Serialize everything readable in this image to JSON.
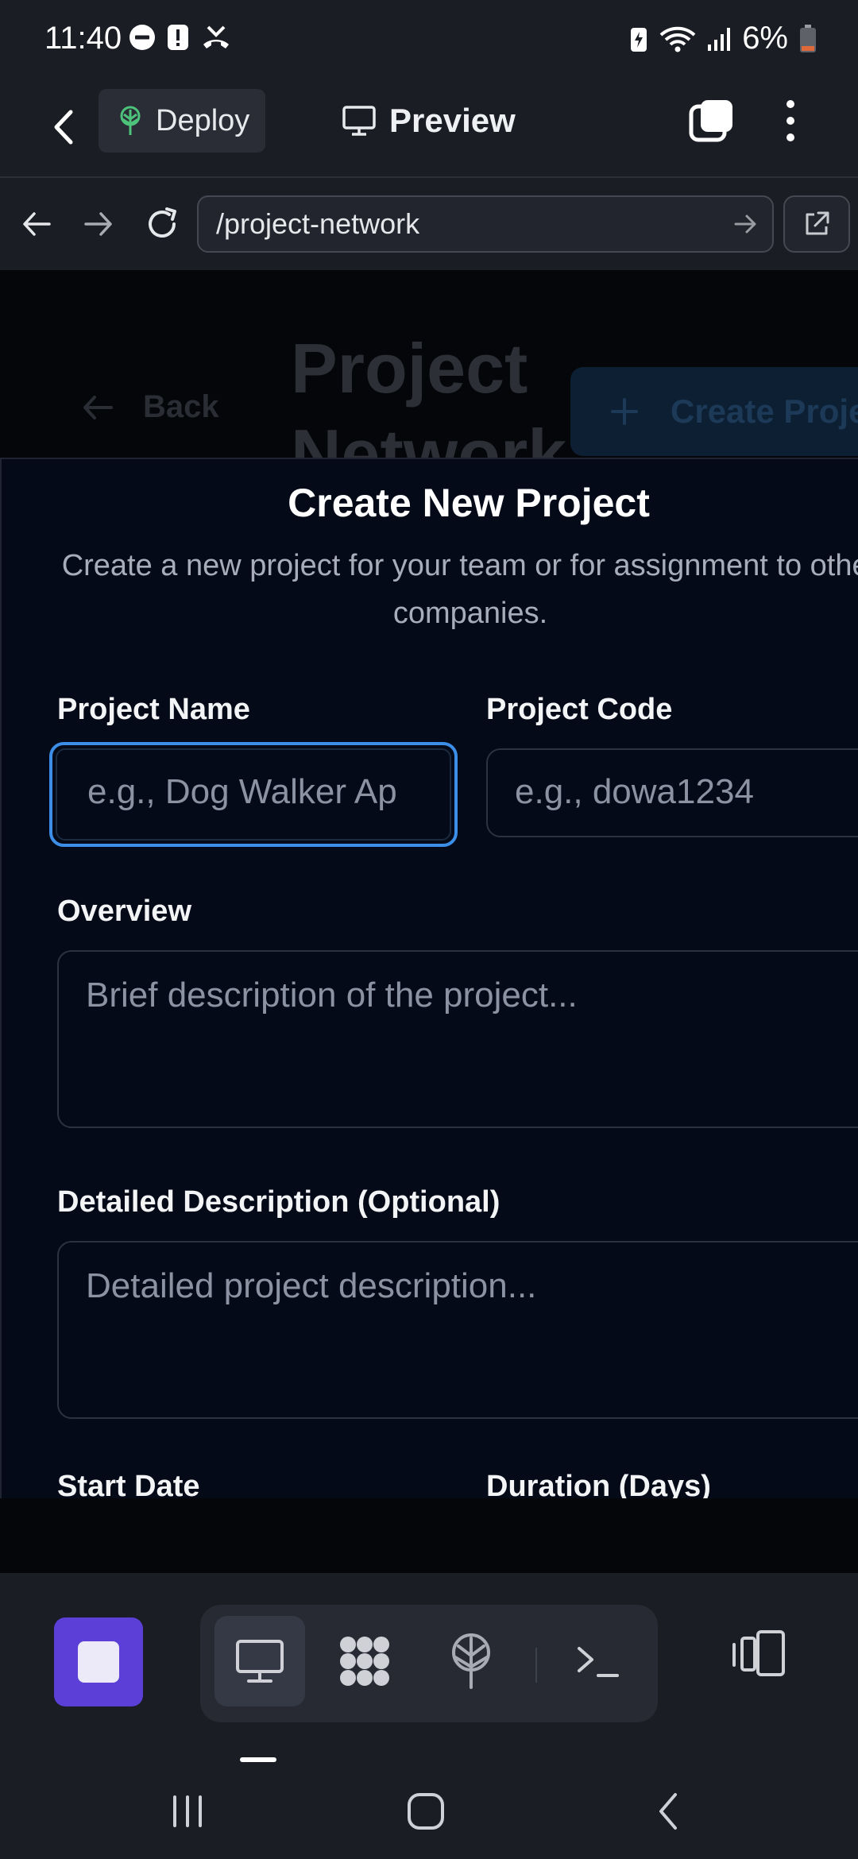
{
  "status_bar": {
    "time": "11:40",
    "battery_percent": "6%",
    "left_icons": [
      "do-not-disturb-icon",
      "alert-icon",
      "missed-call-icon"
    ],
    "right_icons": [
      "battery-saver-icon",
      "wifi-icon",
      "signal-icon",
      "battery-icon"
    ]
  },
  "app_header": {
    "deploy_label": "Deploy",
    "preview_label": "Preview"
  },
  "url_bar": {
    "url": "/project-network"
  },
  "background_page": {
    "back_label": "Back",
    "title": "Project Network",
    "create_button_label": "Create Proje"
  },
  "modal": {
    "title": "Create New Project",
    "subtitle": "Create a new project for your team or for assignment to other companies.",
    "fields": {
      "project_name": {
        "label": "Project Name",
        "placeholder": "e.g., Dog Walker Ap"
      },
      "project_code": {
        "label": "Project Code",
        "placeholder": "e.g., dowa1234"
      },
      "overview": {
        "label": "Overview",
        "placeholder": "Brief description of the project..."
      },
      "detailed_description": {
        "label": "Detailed Description (Optional)",
        "placeholder": "Detailed project description..."
      },
      "start_date": {
        "label": "Start Date"
      },
      "duration": {
        "label": "Duration (Days)"
      }
    }
  },
  "toolbar": {
    "tools": [
      "monitor-icon",
      "apps-grid-icon",
      "deploy-tree-icon",
      "terminal-icon"
    ],
    "active_tool": "monitor-icon",
    "accent_color": "#5b3fd6"
  },
  "colors": {
    "focus_ring": "#3b8fe8",
    "modal_bg": "#050a18",
    "chrome_bg": "#1b1d24"
  }
}
